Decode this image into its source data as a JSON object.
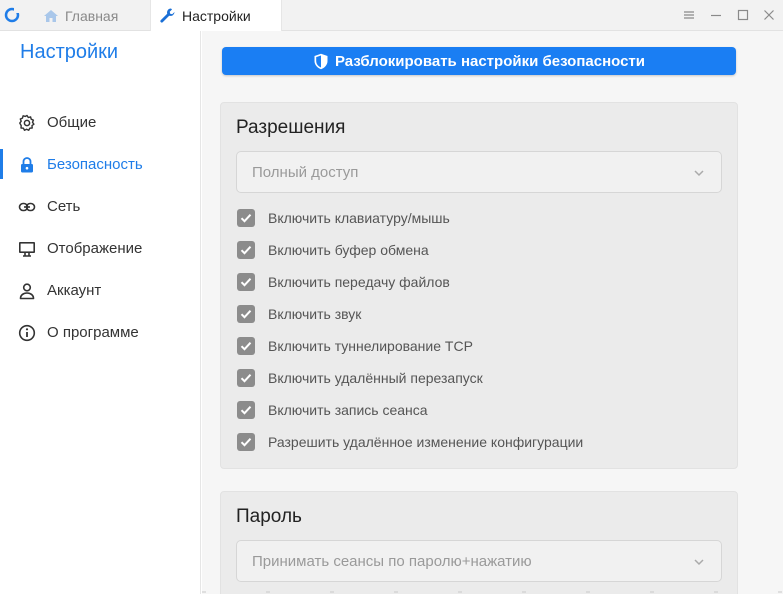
{
  "tabs": [
    {
      "label": "Главная",
      "icon": "home-icon"
    },
    {
      "label": "Настройки",
      "icon": "wrench-icon"
    }
  ],
  "sidebar": {
    "title": "Настройки",
    "items": [
      {
        "label": "Общие",
        "icon": "gear-icon"
      },
      {
        "label": "Безопасность",
        "icon": "lock-icon",
        "active": true
      },
      {
        "label": "Сеть",
        "icon": "link-icon"
      },
      {
        "label": "Отображение",
        "icon": "monitor-icon"
      },
      {
        "label": "Аккаунт",
        "icon": "user-icon"
      },
      {
        "label": "О программе",
        "icon": "info-icon"
      }
    ]
  },
  "main": {
    "unlock_label": "Разблокировать настройки безопасности",
    "permissions": {
      "title": "Разрешения",
      "select_value": "Полный доступ",
      "checkboxes": [
        {
          "label": "Включить клавиатуру/мышь",
          "checked": true
        },
        {
          "label": "Включить буфер обмена",
          "checked": true
        },
        {
          "label": "Включить передачу файлов",
          "checked": true
        },
        {
          "label": "Включить звук",
          "checked": true
        },
        {
          "label": "Включить туннелирование TCP",
          "checked": true
        },
        {
          "label": "Включить удалённый перезапуск",
          "checked": true
        },
        {
          "label": "Включить запись сеанса",
          "checked": true
        },
        {
          "label": "Разрешить удалённое изменение конфигурации",
          "checked": true
        }
      ]
    },
    "password": {
      "title": "Пароль",
      "select_value": "Принимать сеансы по паролю+нажатию"
    }
  },
  "colors": {
    "accent": "#1f7de8",
    "button": "#1a7ef3",
    "checkbox": "#8c8c8c"
  }
}
